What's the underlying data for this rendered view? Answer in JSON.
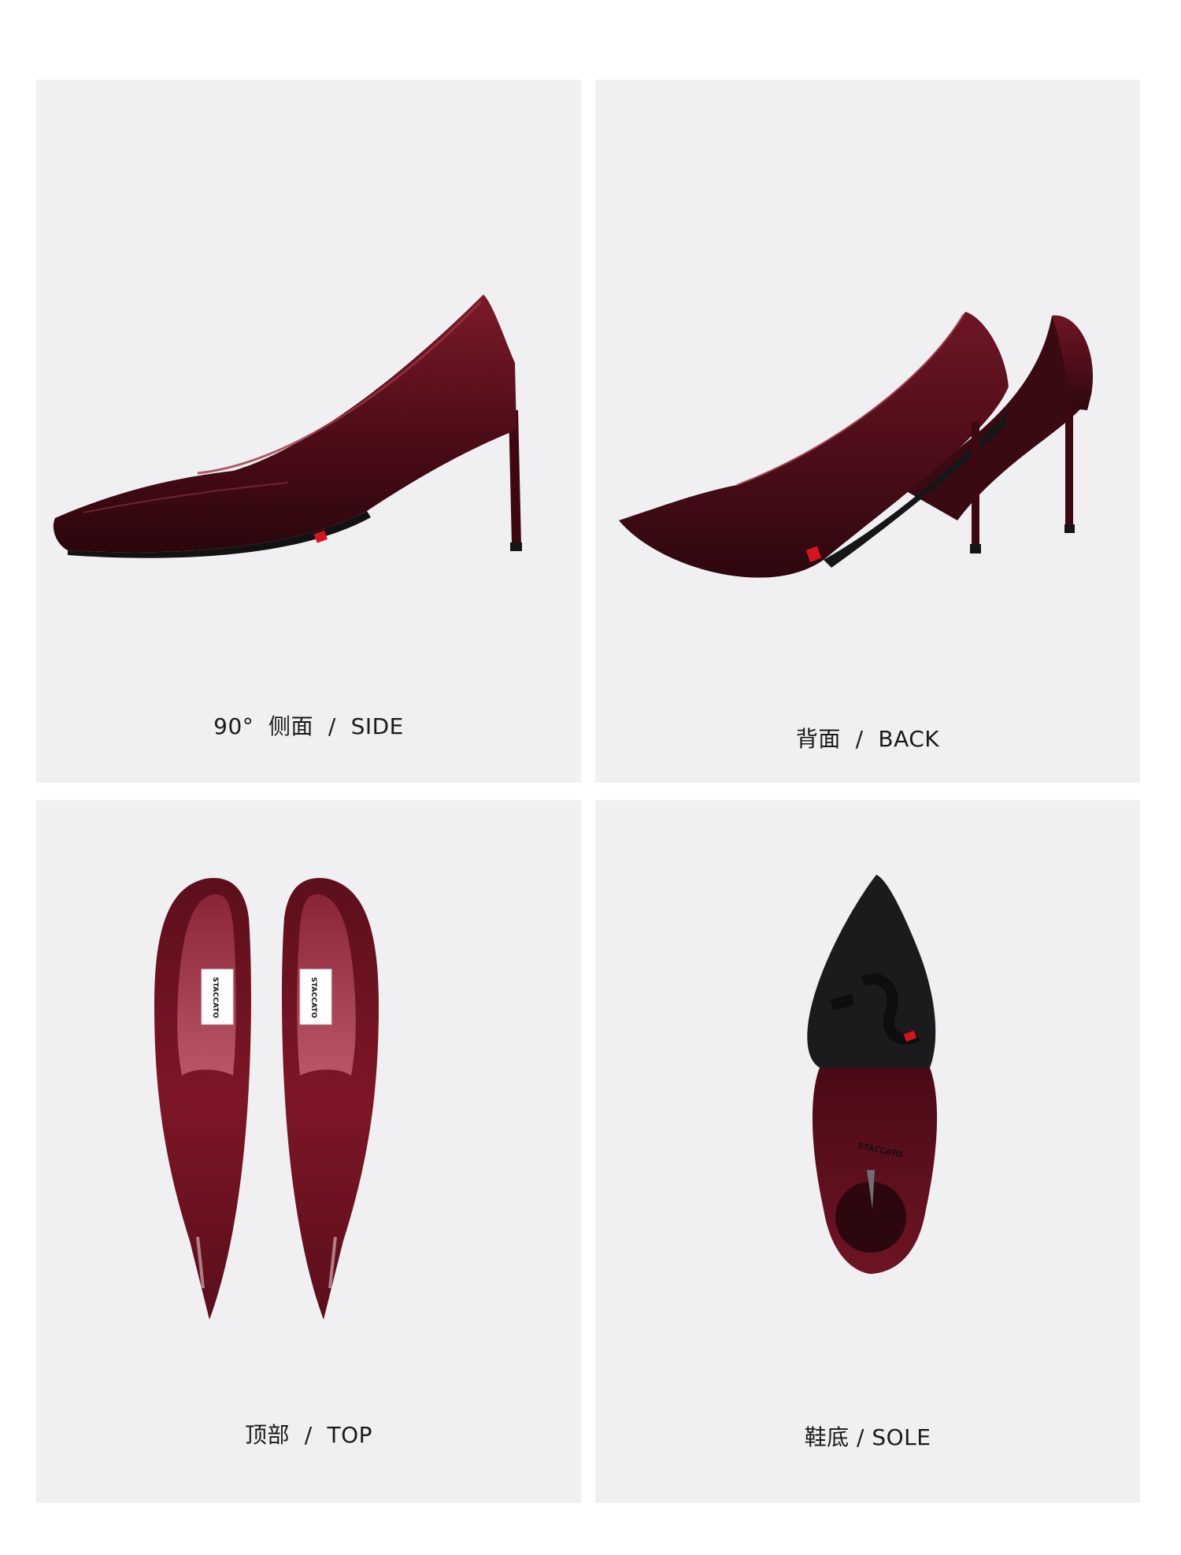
{
  "views": [
    {
      "id": "side",
      "caption": "90°  侧面  /  SIDE"
    },
    {
      "id": "back",
      "caption": "背面  /  BACK"
    },
    {
      "id": "top",
      "caption": "顶部  /  TOP"
    },
    {
      "id": "sole",
      "caption": "鞋底 / SOLE"
    }
  ],
  "product": {
    "brand_on_insole": "STACCATO",
    "brand_on_sole": "STACCATO"
  },
  "colors": {
    "panel_background": "#f0f0f2",
    "patent_burgundy": "#5e0f1c",
    "sole_black": "#1b1b1d",
    "accent_red": "#d4141f",
    "caption_text": "#1a1a1a"
  }
}
